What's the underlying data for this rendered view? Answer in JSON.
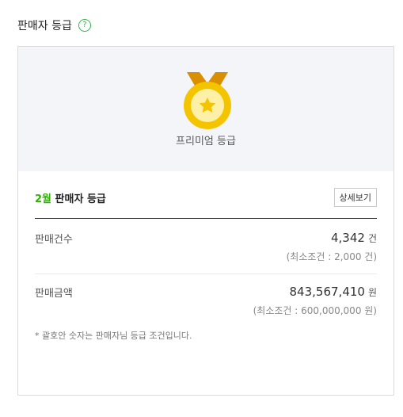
{
  "header": {
    "title": "판매자 등급",
    "help_glyph": "?"
  },
  "grade": {
    "name": "프리미엄 등급",
    "icon": "medal-star-icon",
    "colors": {
      "ribbon": "#d98f00",
      "gold": "#f5c400",
      "inner": "#fff0a8"
    }
  },
  "month_summary": {
    "month": "2월",
    "title": "판매자 등급",
    "detail_button": "상세보기"
  },
  "stats": [
    {
      "label": "판매건수",
      "value": "4,342",
      "unit": "건",
      "condition": "(최소조건 : 2,000 건)"
    },
    {
      "label": "판매금액",
      "value": "843,567,410",
      "unit": "원",
      "condition": "(최소조건 : 600,000,000 원)"
    }
  ],
  "footnote": "* 괄호안 숫자는 판매자님 등급 조건입니다.",
  "accent": "#2db400"
}
